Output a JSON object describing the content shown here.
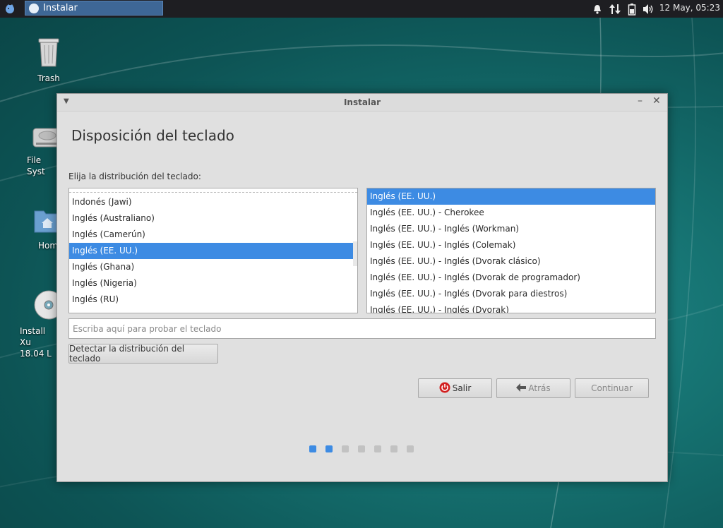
{
  "panel": {
    "task_title": "Instalar",
    "clock": "12 May, 05:23",
    "tray_icons": [
      "bell-icon",
      "network-icon",
      "battery-icon",
      "volume-icon"
    ]
  },
  "desktop": {
    "icons": [
      {
        "name": "trash",
        "label": "Trash"
      },
      {
        "name": "file-system",
        "label": "File Syst"
      },
      {
        "name": "home",
        "label": "Hom"
      },
      {
        "name": "installer",
        "label": "Install Xu\n18.04 L"
      }
    ]
  },
  "window": {
    "title": "Instalar",
    "heading": "Disposición del teclado",
    "prompt": "Elija la distribución del teclado:",
    "layouts": [
      "Indonés (Jawi)",
      "Inglés (Australiano)",
      "Inglés (Camerún)",
      "Inglés (EE. UU.)",
      "Inglés (Ghana)",
      "Inglés (Nigeria)",
      "Inglés (RU)"
    ],
    "layouts_selected": 3,
    "variants": [
      "Inglés (EE. UU.)",
      "Inglés (EE. UU.) - Cherokee",
      "Inglés (EE. UU.) - Inglés (Workman)",
      "Inglés (EE. UU.) - Inglés (Colemak)",
      "Inglés (EE. UU.) - Inglés (Dvorak clásico)",
      "Inglés (EE. UU.) - Inglés (Dvorak de programador)",
      "Inglés (EE. UU.) - Inglés (Dvorak para diestros)",
      "Inglés (EE. UU.) - Inglés (Dvorak)"
    ],
    "variants_selected": 0,
    "test_placeholder": "Escriba aquí para probar el teclado",
    "detect_label": "Detectar la distribución del teclado",
    "quit_label": "Salir",
    "back_label": "Atrás",
    "continue_label": "Continuar",
    "progress": {
      "total": 7,
      "active": 2
    }
  },
  "colors": {
    "selection": "#3d8be3",
    "panel": "#1e1e22",
    "task_active": "#3e6796"
  }
}
